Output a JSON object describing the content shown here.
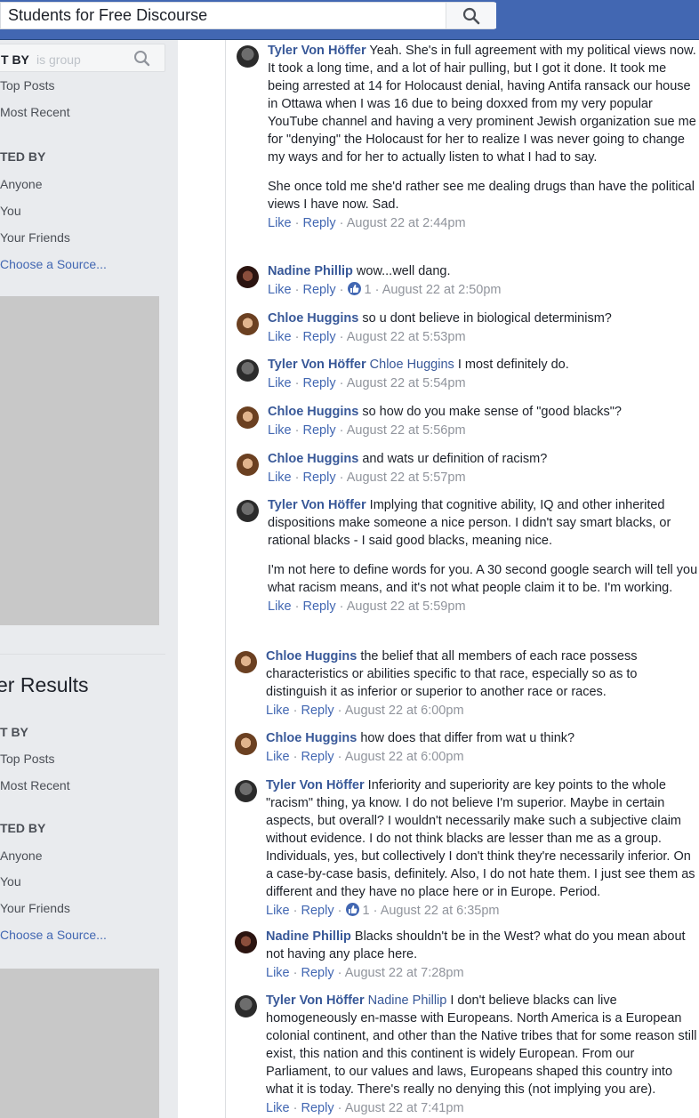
{
  "header": {
    "search_value": "Students for Free Discourse"
  },
  "sidebar": {
    "mini_search": {
      "label": "T BY",
      "placeholder": "is group"
    },
    "section1": {
      "sort_heading": "T BY",
      "sort_options": [
        "Top Posts",
        "Most Recent"
      ],
      "posted_heading": "TED BY",
      "posted_options": [
        "Anyone",
        "You",
        "Your Friends"
      ],
      "choose_source": "Choose a Source..."
    },
    "results_title": "er Results",
    "section2": {
      "sort_heading": "T BY",
      "sort_options": [
        "Top Posts",
        "Most Recent"
      ],
      "posted_heading": "TED BY",
      "posted_options": [
        "Anyone",
        "You",
        "Your Friends"
      ],
      "choose_source": "Choose a Source..."
    }
  },
  "actions": {
    "like": "Like",
    "reply": "Reply",
    "sep": "·"
  },
  "comments": [
    {
      "author": "Tyler Von Höffer",
      "avatar": "tyler",
      "mention": "",
      "paragraphs": [
        "Yeah. She's in full agreement with my political views now. It took a long time, and a lot of hair pulling, but I got it done. It took me being arrested at 14 for Holocaust denial, having Antifa ransack our house in Ottawa when I was 16 due to being doxxed from my very popular YouTube channel and having a very prominent Jewish organization sue me for \"denying\" the Holocaust for her to realize I was never going to change my ways and for her to actually listen to what I had to say.",
        "She once told me she'd rather see me dealing drugs than have the political views I have now. Sad."
      ],
      "reactions": "",
      "time": "August 22 at 2:44pm"
    },
    {
      "author": "Nadine Phillip",
      "avatar": "nadine",
      "mention": "",
      "paragraphs": [
        "wow...well dang."
      ],
      "reactions": "1",
      "time": "August 22 at 2:50pm"
    },
    {
      "author": "Chloe Huggins",
      "avatar": "chloe",
      "mention": "",
      "paragraphs": [
        "so u dont believe in biological determinism?"
      ],
      "reactions": "",
      "time": "August 22 at 5:53pm"
    },
    {
      "author": "Tyler Von Höffer",
      "avatar": "tyler",
      "mention": "Chloe Huggins",
      "paragraphs": [
        "I most definitely do."
      ],
      "reactions": "",
      "time": "August 22 at 5:54pm"
    },
    {
      "author": "Chloe Huggins",
      "avatar": "chloe",
      "mention": "",
      "paragraphs": [
        "so how do you make sense of \"good blacks\"?"
      ],
      "reactions": "",
      "time": "August 22 at 5:56pm"
    },
    {
      "author": "Chloe Huggins",
      "avatar": "chloe",
      "mention": "",
      "paragraphs": [
        "and wats ur definition of racism?"
      ],
      "reactions": "",
      "time": "August 22 at 5:57pm"
    },
    {
      "author": "Tyler Von Höffer",
      "avatar": "tyler",
      "mention": "",
      "paragraphs": [
        "Implying that cognitive ability, IQ and other inherited dispositions make someone a nice person. I didn't say smart blacks, or rational blacks - I said good blacks, meaning nice.",
        "I'm not here to define words for you. A 30 second google search will tell you what racism means, and it's not what people claim it to be. I'm working."
      ],
      "reactions": "",
      "time": "August 22 at 5:59pm"
    },
    {
      "author": "Chloe Huggins",
      "avatar": "chloe",
      "mention": "",
      "paragraphs": [
        "the belief that all members of each race possess characteristics or abilities specific to that race, especially so as to distinguish it as inferior or superior to another race or races."
      ],
      "reactions": "",
      "time": "August 22 at 6:00pm"
    },
    {
      "author": "Chloe Huggins",
      "avatar": "chloe",
      "mention": "",
      "paragraphs": [
        "how does that differ from wat u think?"
      ],
      "reactions": "",
      "time": "August 22 at 6:00pm"
    },
    {
      "author": "Tyler Von Höffer",
      "avatar": "tyler",
      "mention": "",
      "paragraphs": [
        "Inferiority and superiority are key points to the whole \"racism\" thing, ya know. I do not believe I'm superior. Maybe in certain aspects, but overall? I wouldn't necessarily make such a subjective claim without evidence. I do not think blacks are lesser than me as a group. Individuals, yes, but collectively I don't think they're necessarily inferior. On a case-by-case basis, definitely. Also, I do not hate them. I just see them as different and they have no place here or in Europe. Period."
      ],
      "reactions": "1",
      "time": "August 22 at 6:35pm"
    },
    {
      "author": "Nadine Phillip",
      "avatar": "nadine",
      "mention": "",
      "paragraphs": [
        "Blacks shouldn't be in the West? what do you mean about not having any place here."
      ],
      "reactions": "",
      "time": "August 22 at 7:28pm"
    },
    {
      "author": "Tyler Von Höffer",
      "avatar": "tyler",
      "mention": "Nadine Phillip",
      "paragraphs": [
        "I don't believe blacks can live homogeneously en-masse with Europeans. North America is a European colonial continent, and other than the Native tribes that for some reason still exist, this nation and this continent is widely European. From our Parliament, to our values and laws, Europeans shaped this country into what it is today. There's really no denying this (not implying you are)."
      ],
      "reactions": "",
      "time": "August 22 at 7:41pm"
    }
  ]
}
